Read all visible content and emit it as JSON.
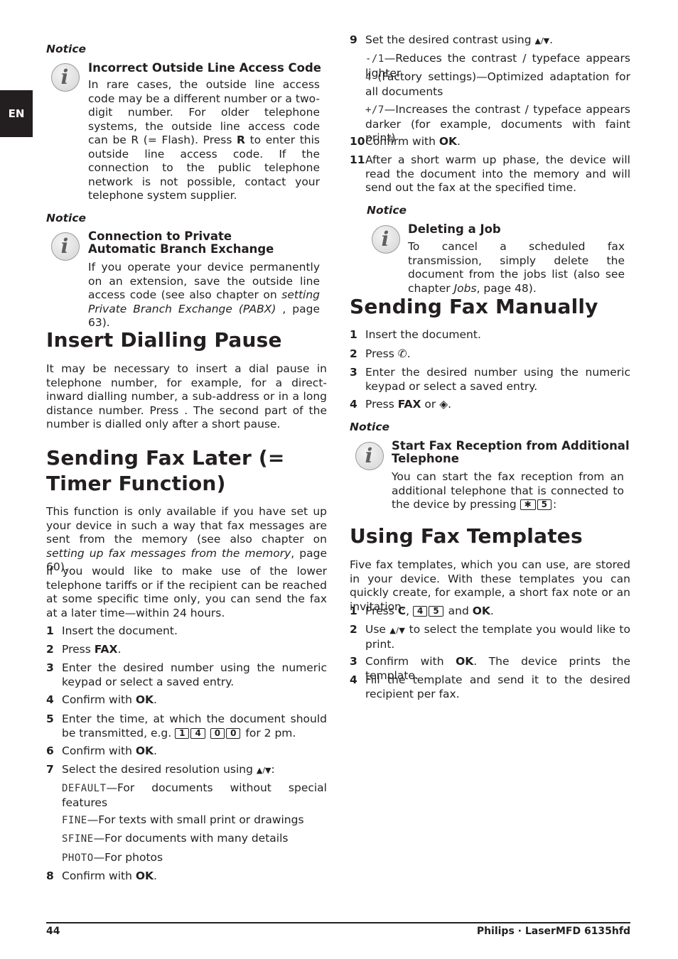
{
  "lang_tab": "EN",
  "left": {
    "notice1": {
      "label": "Notice",
      "title": "Incorrect Outside Line Access Code",
      "body_a": "In rare cases, the outside line access code may be a different number or a two-digit number. For older telephone systems, the outside line access code can be R (= Flash). Press ",
      "body_key": "R",
      "body_b": " to enter this outside line access code. If the connection to the public telephone network is not possible, contact your telephone system supplier."
    },
    "notice2": {
      "label": "Notice",
      "title": "Connection to Private Automatic Branch Exchange",
      "body_a": "If you operate your device permanently on an extension, save the outside line access code (see also chapter on ",
      "body_link": "setting Private Branch Exchange (PABX)",
      "body_b": " , page 63)."
    },
    "pause": {
      "heading": "Insert Dialling Pause",
      "body": "It may be necessary to insert a dial pause in telephone number, for example, for a direct-inward dialling number, a sub-address or in a long distance number. Press . The second part of the number is dialled only after a short pause."
    },
    "later": {
      "heading": "Sending Fax Later (= Timer Function)",
      "para1_a": "This function is only available if you have set up your device in such a way that fax messages are sent from the memory (see also chapter on ",
      "para1_link": "setting up fax messages from the memory",
      "para1_b": ", page 60).",
      "para2": "If you would like to make use of the lower telephone tariffs or if the recipient can be reached at some specific time only, you can send the fax at a later time—within 24 hours.",
      "steps": [
        {
          "num": "1",
          "text": "Insert the document."
        },
        {
          "num": "2",
          "pre": "Press ",
          "bold": "FAX",
          "post": "."
        },
        {
          "num": "3",
          "text": "Enter the desired number using the numeric keypad or select a saved entry."
        },
        {
          "num": "4",
          "pre": "Confirm with ",
          "bold": "OK",
          "post": "."
        },
        {
          "num": "5",
          "pre": "Enter the time, at which the document should be transmitted, e.g. ",
          "keys1": [
            "1",
            "4"
          ],
          "keys2": [
            "0",
            "0"
          ],
          "post": " for 2 pm."
        },
        {
          "num": "6",
          "pre": "Confirm with ",
          "bold": "OK",
          "post": "."
        },
        {
          "num": "7",
          "pre": "Select the desired resolution using ",
          "arrows": "▲/▼",
          "post": ":"
        },
        {
          "num": "8",
          "pre": "Confirm with ",
          "bold": "OK",
          "post": "."
        }
      ],
      "resolutions": [
        {
          "lcd": "DEFAULT",
          "text": "—For documents without special features"
        },
        {
          "lcd": "FINE",
          "text": "—For texts with small print or drawings"
        },
        {
          "lcd": "SFINE",
          "text": "—For documents with many details"
        },
        {
          "lcd": "PHOTO",
          "text": "—For photos"
        }
      ]
    }
  },
  "right": {
    "steps_cont": [
      {
        "num": "9",
        "pre": "Set the desired contrast using ",
        "arrows": "▲/▼",
        "post": "."
      },
      {
        "num": "10",
        "pre": "Confirm with ",
        "bold": "OK",
        "post": "."
      },
      {
        "num": "11",
        "text": "After a short warm up phase, the device will read the document into the memory and will send out the fax at the specified time."
      }
    ],
    "contrast": [
      {
        "lcd": "-/1",
        "text": "—Reduces the contrast / typeface appears lighter"
      },
      {
        "lcd": "4",
        "text": " (Factory settings)—Optimized adaptation for all documents"
      },
      {
        "lcd": "+/7",
        "text": "—Increases the contrast / typeface appears darker (for example, documents with faint print)"
      }
    ],
    "notice3": {
      "label": "Notice",
      "title": "Deleting a Job",
      "body_a": "To cancel a scheduled fax transmission, simply delete the document from the jobs list (also see chapter ",
      "body_link": "Jobs",
      "body_b": ", page 48)."
    },
    "manual": {
      "heading": "Sending Fax Manually",
      "steps": [
        {
          "num": "1",
          "text": "Insert the document."
        },
        {
          "num": "2",
          "pre": "Press ",
          "icon": "✆",
          "post": "."
        },
        {
          "num": "3",
          "text": "Enter the desired number using the numeric keypad or select a saved entry."
        },
        {
          "num": "4",
          "pre": "Press ",
          "bold": "FAX",
          "mid": " or ",
          "icon": "◈",
          "post": "."
        }
      ]
    },
    "notice4": {
      "label": "Notice",
      "title": "Start Fax Reception from Additional Telephone",
      "body_a": "You can start the fax reception from an additional telephone that is connected to the device by pressing ",
      "keys": [
        "✱",
        "5"
      ],
      "body_b": ":"
    },
    "templates": {
      "heading": "Using Fax Templates",
      "intro": "Five fax templates, which you can use, are stored in your device. With these templates you can quickly create, for example, a short fax note or an invitation.",
      "steps": [
        {
          "num": "1",
          "pre": "Press ",
          "bold": "C",
          "mid": ", ",
          "keys": [
            "4",
            "5"
          ],
          "mid2": " and ",
          "bold2": "OK",
          "post": "."
        },
        {
          "num": "2",
          "pre": "Use ",
          "arrows": "▲/▼",
          "post": " to select the template you would like to print."
        },
        {
          "num": "3",
          "pre": "Confirm with ",
          "bold": "OK",
          "post": ". The device prints the template."
        },
        {
          "num": "4",
          "text": "Fill the template and send it to the desired recipient per fax."
        }
      ]
    }
  },
  "footer": {
    "page_number": "44",
    "product": "Philips · LaserMFD 6135hfd"
  }
}
